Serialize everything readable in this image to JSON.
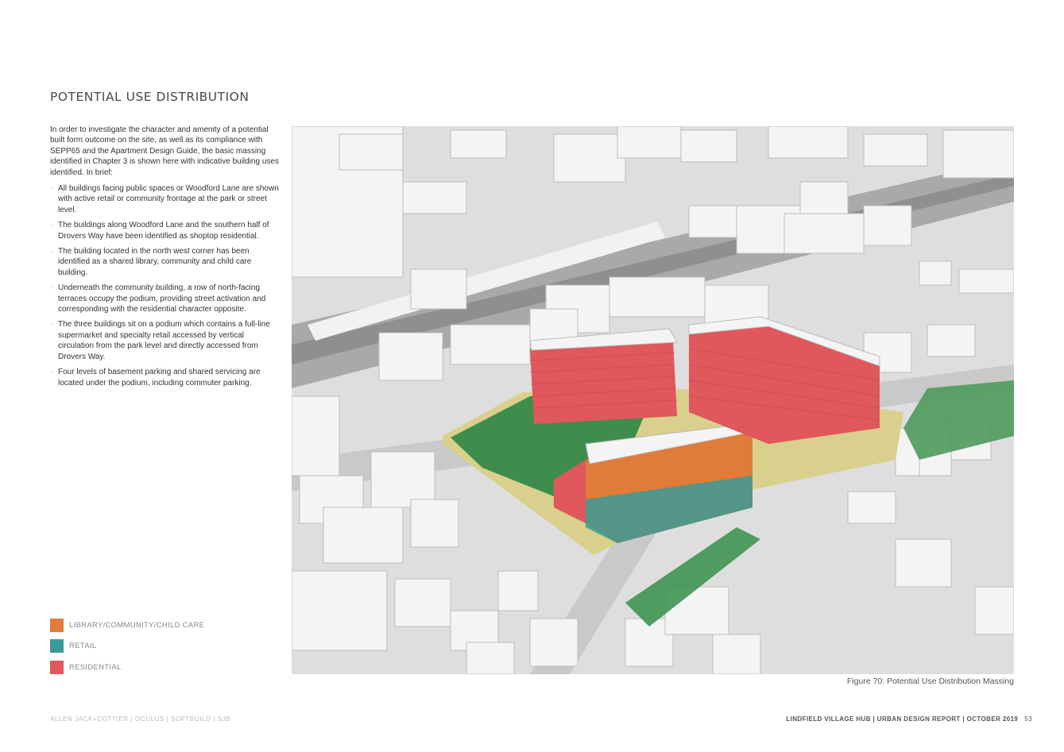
{
  "page": {
    "title": "POTENTIAL USE DISTRIBUTION",
    "intro": "In order to investigate the character and amenity of a potential built form outcome on the site, as well as its compliance with SEPP65 and the Apartment Design Guide, the basic massing identified in Chapter 3 is shown here with indicative building uses identified. In brief:",
    "bullets": [
      "All buildings facing public spaces or Woodford Lane are shown with active retail or community frontage at the park or street level.",
      "The buildings along Woodford Lane and the southern half of Drovers Way have been identified as shoptop residential.",
      "The building located in the north west corner  has been identified as a shared library, community and child care building.",
      "Underneath the community building, a row of north-facing terraces occupy the podium,  providing street activation and corresponding with the residential character opposite.",
      "The three buildings sit on a podium which contains a full-line supermarket and specialty retail accessed by vertical circulation from the park level and directly accessed from Drovers Way.",
      "Four levels of basement parking and shared servicing are located under the podium, including commuter parking."
    ],
    "bullet_glyph": "·"
  },
  "legend": [
    {
      "label": "LIBRARY/COMMUNITY/CHILD CARE",
      "color": "#e07b39"
    },
    {
      "label": "RETAIL",
      "color": "#3a9a97"
    },
    {
      "label": "RESIDENTIAL",
      "color": "#e0575c"
    }
  ],
  "figure": {
    "caption": "Figure 70:  Potential Use Distribution Massing"
  },
  "footer": {
    "left": "ALLEN JACK+COTTIER  |  OCULUS  |  SOFTBUILD  |  SJB",
    "right": "LINDFIELD VILLAGE HUB | URBAN DESIGN REPORT | OCTOBER 2019",
    "page_number": "53"
  }
}
